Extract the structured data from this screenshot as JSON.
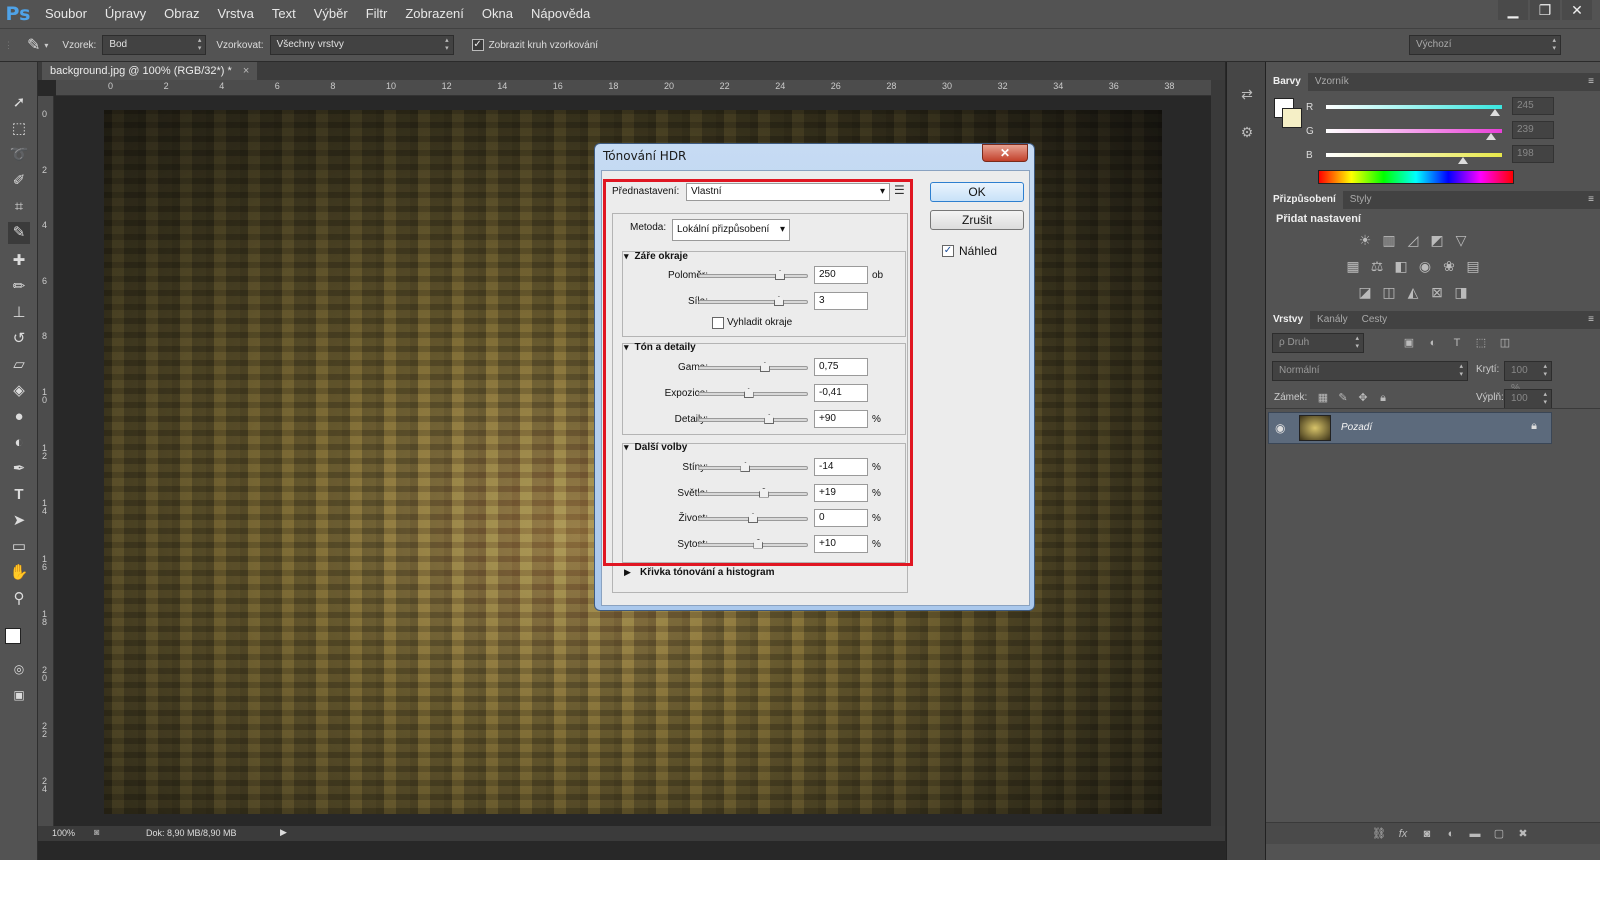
{
  "menubar": {
    "logo": "Ps",
    "items": [
      "Soubor",
      "Úpravy",
      "Obraz",
      "Vrstva",
      "Text",
      "Výběr",
      "Filtr",
      "Zobrazení",
      "Okna",
      "Nápověda"
    ],
    "window_controls": [
      "▁",
      "❐",
      "✕"
    ]
  },
  "options": {
    "tool_icon": "eyedropper-icon",
    "sample_label": "Vzorek:",
    "sample_value": "Bod",
    "sampling_label": "Vzorkovat:",
    "sampling_value": "Všechny vrstvy",
    "show_ring_label": "Zobrazit kruh vzorkování",
    "show_ring_checked": "✓",
    "workspace": "Výchozí"
  },
  "document": {
    "tab_title": "background.jpg @ 100% (RGB/32*) *",
    "tab_close": "×",
    "h_ruler": [
      "0",
      "2",
      "4",
      "6",
      "8",
      "10",
      "12",
      "14",
      "16",
      "18",
      "20",
      "22",
      "24",
      "26",
      "28",
      "30",
      "32",
      "34",
      "36",
      "38"
    ],
    "v_ruler": [
      "0",
      "2",
      "4",
      "6",
      "8",
      "1\n0",
      "1\n2",
      "1\n4",
      "1\n6",
      "1\n8",
      "2\n0",
      "2\n2",
      "2\n4"
    ]
  },
  "status": {
    "zoom": "100%",
    "doc_info": "Dok: 8,90 MB/8,90 MB"
  },
  "color_panel": {
    "tabs": [
      "Barvy",
      "Vzorník"
    ],
    "channels": [
      {
        "label": "R",
        "value": "245",
        "fraction": 0.96,
        "color": "#39e7e0"
      },
      {
        "label": "G",
        "value": "239",
        "fraction": 0.94,
        "color": "#e93fd8"
      },
      {
        "label": "B",
        "value": "198",
        "fraction": 0.78,
        "color": "#e8e84a"
      }
    ]
  },
  "adjust_panel": {
    "tabs": [
      "Přizpůsobení",
      "Styly"
    ],
    "heading": "Přidat nastavení"
  },
  "layers_panel": {
    "tabs": [
      "Vrstvy",
      "Kanály",
      "Cesty"
    ],
    "filter": "ρ Druh",
    "blend_mode": "Normální",
    "opacity_label": "Krytí:",
    "opacity_value": "100 %",
    "lock_label": "Zámek:",
    "fill_label": "Výplň:",
    "fill_value": "100 %",
    "layer_name": "Pozadí"
  },
  "dialog": {
    "title": "Tónování HDR",
    "close": "✕",
    "preset_label": "Přednastavení:",
    "preset_value": "Vlastní",
    "method_label": "Metoda:",
    "method_value": "Lokální přizpůsobení",
    "ok": "OK",
    "cancel": "Zrušit",
    "preview_label": "Náhled",
    "preview_checked": "✓",
    "edge_glow": {
      "title": "Záře okraje",
      "rows": [
        {
          "label": "Poloměr:",
          "value": "250",
          "unit": "ob",
          "pos": 0.75
        },
        {
          "label": "Síla:",
          "value": "3",
          "unit": "",
          "pos": 0.74
        }
      ],
      "smooth_label": "Vyhladit okraje"
    },
    "tone_detail": {
      "title": "Tón a detaily",
      "rows": [
        {
          "label": "Gama:",
          "value": "0,75",
          "unit": "",
          "pos": 0.61
        },
        {
          "label": "Expozice:",
          "value": "-0,41",
          "unit": "",
          "pos": 0.46
        },
        {
          "label": "Detaily:",
          "value": "+90",
          "unit": "%",
          "pos": 0.65
        }
      ]
    },
    "advanced": {
      "title": "Další volby",
      "rows": [
        {
          "label": "Stíny:",
          "value": "-14",
          "unit": "%",
          "pos": 0.43
        },
        {
          "label": "Světla:",
          "value": "+19",
          "unit": "%",
          "pos": 0.6
        },
        {
          "label": "Živost:",
          "value": "0",
          "unit": "%",
          "pos": 0.5
        },
        {
          "label": "Sytost:",
          "value": "+10",
          "unit": "%",
          "pos": 0.55
        }
      ]
    },
    "curve_section": "Křivka tónování a histogram"
  }
}
